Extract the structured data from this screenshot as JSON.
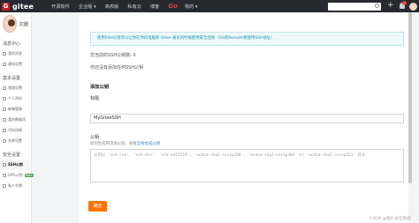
{
  "header": {
    "logo_text": "gitee",
    "nav": [
      "开源软件",
      "企业版 ▾",
      "高校版",
      "私有云",
      "博客"
    ],
    "go_label": "Go",
    "mine_label": "我的 ▾",
    "search_placeholder": ""
  },
  "sidebar": {
    "username": "文嫚",
    "sections": [
      {
        "title": "消息中心",
        "items": [
          {
            "label": "我的消息"
          },
          {
            "label": "通知设置"
          }
        ]
      },
      {
        "title": "基本设置",
        "items": [
          {
            "label": "常规设置"
          },
          {
            "label": "个人资料"
          },
          {
            "label": "邮箱管理"
          },
          {
            "label": "我的数据项"
          },
          {
            "label": "代码风格"
          },
          {
            "label": "仓库设置"
          }
        ]
      },
      {
        "title": "安全设置",
        "items": [
          {
            "label": "SSH公钥",
            "active": true
          },
          {
            "label": "GPG公钥",
            "badge": "Beta"
          },
          {
            "label": "私人令牌"
          }
        ]
      }
    ]
  },
  "main": {
    "tip": "使用SSH公钥可以让你在你的电脑和 Gitee 通讯的时候使用安全连接（Git的Remote要使用SSH地址）",
    "ssh_count": "您当前的SSH公钥数: 0",
    "no_keys": "你还没有添加任何SSH公钥",
    "add_heading": "添加公钥",
    "title_label": "标题",
    "title_value": "MyGiteeSSH",
    "key_label": "公钥",
    "key_hint_prefix": "如何生成和添加公钥，查看",
    "key_hint_link": "怎样生成公钥",
    "key_placeholder": "公钥以 'ssh-rsa', 'ssh-dss', 'ssh-ed25519', 'ecdsa-sha2-nistp256', 'ecdsa-sha2-nistp384' or 'ecdsa-sha2-nistp521' 开头",
    "confirm_button": "确定"
  },
  "watermark": "CSDN @图片未见到底"
}
